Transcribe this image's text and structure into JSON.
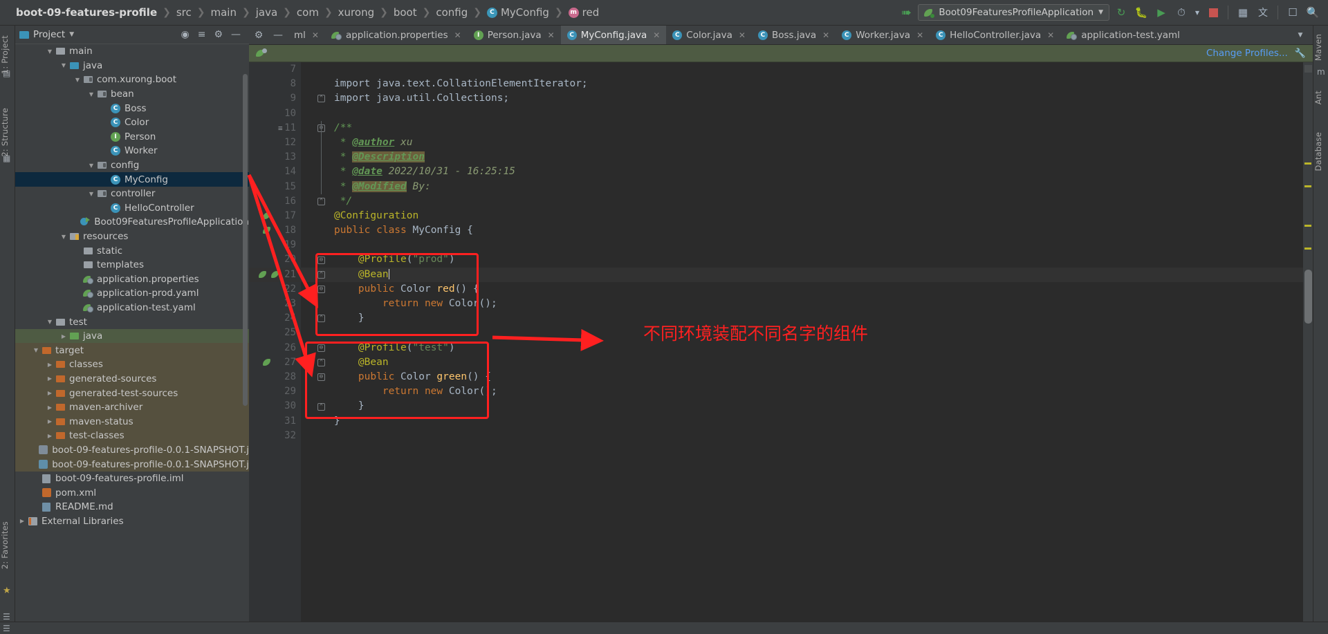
{
  "window": {
    "breadcrumb": [
      {
        "label": "boot-09-features-profile",
        "icon": "",
        "bold": true
      },
      {
        "label": "src",
        "icon": "",
        "bold": false
      },
      {
        "label": "main",
        "icon": "",
        "bold": false
      },
      {
        "label": "java",
        "icon": "",
        "bold": false
      },
      {
        "label": "com",
        "icon": "",
        "bold": false
      },
      {
        "label": "xurong",
        "icon": "",
        "bold": false
      },
      {
        "label": "boot",
        "icon": "",
        "bold": false
      },
      {
        "label": "config",
        "icon": "",
        "bold": false
      },
      {
        "label": "MyConfig",
        "icon": "class-icon",
        "bold": false
      },
      {
        "label": "red",
        "icon": "method-icon",
        "bold": false
      }
    ],
    "run_configuration": "Boot09FeaturesProfileApplication",
    "toolbar_icons": [
      "build-icon",
      "debug-icon",
      "run-with-coverage-icon",
      "profiler-icon",
      "stop-icon",
      "services-icon",
      "translate-icon",
      "terminal-icon",
      "search-everywhere-icon"
    ]
  },
  "left_tool_strip": [
    "1: Project",
    "2: Structure",
    "2: Favorites"
  ],
  "right_tool_strip": [
    "Maven",
    "Ant",
    "Database"
  ],
  "project_panel": {
    "title": "Project",
    "tree": [
      {
        "indent": 2,
        "arrow": "down",
        "icon": "folder-gray",
        "label": "main",
        "row": "normal"
      },
      {
        "indent": 3,
        "arrow": "down",
        "icon": "folder-blue",
        "label": "java",
        "row": "normal"
      },
      {
        "indent": 4,
        "arrow": "down",
        "icon": "package",
        "label": "com.xurong.boot",
        "row": "normal"
      },
      {
        "indent": 5,
        "arrow": "down",
        "icon": "package",
        "label": "bean",
        "row": "normal"
      },
      {
        "indent": 6,
        "arrow": "none",
        "icon": "class",
        "label": "Boss",
        "row": "normal"
      },
      {
        "indent": 6,
        "arrow": "none",
        "icon": "class",
        "label": "Color",
        "row": "normal"
      },
      {
        "indent": 6,
        "arrow": "none",
        "icon": "interface",
        "label": "Person",
        "row": "normal"
      },
      {
        "indent": 6,
        "arrow": "none",
        "icon": "class",
        "label": "Worker",
        "row": "normal"
      },
      {
        "indent": 5,
        "arrow": "down",
        "icon": "package",
        "label": "config",
        "row": "normal"
      },
      {
        "indent": 6,
        "arrow": "none",
        "icon": "class",
        "label": "MyConfig",
        "row": "selected"
      },
      {
        "indent": 5,
        "arrow": "down",
        "icon": "package",
        "label": "controller",
        "row": "normal"
      },
      {
        "indent": 6,
        "arrow": "none",
        "icon": "class",
        "label": "HelloController",
        "row": "normal"
      },
      {
        "indent": 5,
        "arrow": "none",
        "icon": "run-class",
        "label": "Boot09FeaturesProfileApplication",
        "row": "normal"
      },
      {
        "indent": 3,
        "arrow": "down",
        "icon": "folder-res",
        "label": "resources",
        "row": "normal"
      },
      {
        "indent": 4,
        "arrow": "none",
        "icon": "folder-gray",
        "label": "static",
        "row": "normal"
      },
      {
        "indent": 4,
        "arrow": "none",
        "icon": "folder-gray",
        "label": "templates",
        "row": "normal"
      },
      {
        "indent": 4,
        "arrow": "none",
        "icon": "spring-leaf",
        "label": "application.properties",
        "row": "normal"
      },
      {
        "indent": 4,
        "arrow": "none",
        "icon": "spring-leaf",
        "label": "application-prod.yaml",
        "row": "normal"
      },
      {
        "indent": 4,
        "arrow": "none",
        "icon": "spring-leaf",
        "label": "application-test.yaml",
        "row": "normal"
      },
      {
        "indent": 2,
        "arrow": "down",
        "icon": "folder-gray",
        "label": "test",
        "row": "normal"
      },
      {
        "indent": 3,
        "arrow": "right",
        "icon": "folder-green",
        "label": "java",
        "row": "green"
      },
      {
        "indent": 1,
        "arrow": "down",
        "icon": "folder-orange",
        "label": "target",
        "row": "brown"
      },
      {
        "indent": 2,
        "arrow": "right",
        "icon": "folder-orange",
        "label": "classes",
        "row": "brown"
      },
      {
        "indent": 2,
        "arrow": "right",
        "icon": "folder-orange",
        "label": "generated-sources",
        "row": "brown"
      },
      {
        "indent": 2,
        "arrow": "right",
        "icon": "folder-orange",
        "label": "generated-test-sources",
        "row": "brown"
      },
      {
        "indent": 2,
        "arrow": "right",
        "icon": "folder-orange",
        "label": "maven-archiver",
        "row": "brown"
      },
      {
        "indent": 2,
        "arrow": "right",
        "icon": "folder-orange",
        "label": "maven-status",
        "row": "brown"
      },
      {
        "indent": 2,
        "arrow": "right",
        "icon": "folder-orange",
        "label": "test-classes",
        "row": "brown"
      },
      {
        "indent": 2,
        "arrow": "none",
        "icon": "jar",
        "label": "boot-09-features-profile-0.0.1-SNAPSHOT.j",
        "row": "brown"
      },
      {
        "indent": 2,
        "arrow": "none",
        "icon": "jar-blue",
        "label": "boot-09-features-profile-0.0.1-SNAPSHOT.j",
        "row": "brown"
      },
      {
        "indent": 1,
        "arrow": "none",
        "icon": "iml",
        "label": "boot-09-features-profile.iml",
        "row": "normal"
      },
      {
        "indent": 1,
        "arrow": "none",
        "icon": "maven",
        "label": "pom.xml",
        "row": "normal"
      },
      {
        "indent": 1,
        "arrow": "none",
        "icon": "markdown",
        "label": "README.md",
        "row": "normal"
      },
      {
        "indent": 0,
        "arrow": "right",
        "icon": "libraries",
        "label": "External Libraries",
        "row": "normal"
      }
    ]
  },
  "editor": {
    "tabs": [
      {
        "label": "ml",
        "icon": "none",
        "active": false,
        "closable": true
      },
      {
        "label": "application.properties",
        "icon": "spring",
        "active": false,
        "closable": true
      },
      {
        "label": "Person.java",
        "icon": "interface",
        "active": false,
        "closable": true
      },
      {
        "label": "MyConfig.java",
        "icon": "class",
        "active": true,
        "closable": true
      },
      {
        "label": "Color.java",
        "icon": "class",
        "active": false,
        "closable": true
      },
      {
        "label": "Boss.java",
        "icon": "class",
        "active": false,
        "closable": true
      },
      {
        "label": "Worker.java",
        "icon": "class",
        "active": false,
        "closable": true
      },
      {
        "label": "HelloController.java",
        "icon": "class",
        "active": false,
        "closable": true
      },
      {
        "label": "application-test.yaml",
        "icon": "spring",
        "active": false,
        "closable": false
      }
    ],
    "notification_bar": {
      "icon": "spring-profile-icon",
      "action_label": "Change Profiles...",
      "settings_icon": "wrench-icon"
    },
    "first_line_number": 7,
    "current_line": 21,
    "lines": [
      {
        "n": 7,
        "tokens": []
      },
      {
        "n": 8,
        "tokens": [
          {
            "t": "import java.text.CollationElementIterator;",
            "c": "plain"
          }
        ]
      },
      {
        "n": 9,
        "tokens": [
          {
            "t": "import java.util.Collections;",
            "c": "plain"
          }
        ]
      },
      {
        "n": 10,
        "tokens": []
      },
      {
        "n": 11,
        "tokens": [
          {
            "t": "/**",
            "c": "cmt"
          }
        ]
      },
      {
        "n": 12,
        "tokens": [
          {
            "t": " * ",
            "c": "cmt"
          },
          {
            "t": "@author",
            "c": "tag"
          },
          {
            "t": " xu",
            "c": "cmtt"
          }
        ]
      },
      {
        "n": 13,
        "tokens": [
          {
            "t": " * ",
            "c": "cmt"
          },
          {
            "t": "@Description",
            "c": "tag-hl"
          }
        ]
      },
      {
        "n": 14,
        "tokens": [
          {
            "t": " * ",
            "c": "cmt"
          },
          {
            "t": "@date",
            "c": "tag"
          },
          {
            "t": " 2022/10/31 - 16:25:15",
            "c": "cmtt"
          }
        ]
      },
      {
        "n": 15,
        "tokens": [
          {
            "t": " * ",
            "c": "cmt"
          },
          {
            "t": "@Modified",
            "c": "tag-hl"
          },
          {
            "t": " By:",
            "c": "cmtt"
          }
        ]
      },
      {
        "n": 16,
        "tokens": [
          {
            "t": " */",
            "c": "cmt"
          }
        ]
      },
      {
        "n": 17,
        "tokens": [
          {
            "t": "@Configuration",
            "c": "anno"
          }
        ]
      },
      {
        "n": 18,
        "tokens": [
          {
            "t": "public class ",
            "c": "kw"
          },
          {
            "t": "MyConfig {",
            "c": "plain"
          }
        ]
      },
      {
        "n": 19,
        "tokens": []
      },
      {
        "n": 20,
        "tokens": [
          {
            "t": "    ",
            "c": "plain"
          },
          {
            "t": "@Profile",
            "c": "anno"
          },
          {
            "t": "(",
            "c": "paren"
          },
          {
            "t": "\"prod\"",
            "c": "str"
          },
          {
            "t": ")",
            "c": "paren"
          }
        ]
      },
      {
        "n": 21,
        "tokens": [
          {
            "t": "    ",
            "c": "plain"
          },
          {
            "t": "@Bean",
            "c": "anno"
          }
        ],
        "caret": true
      },
      {
        "n": 22,
        "tokens": [
          {
            "t": "    ",
            "c": "plain"
          },
          {
            "t": "public ",
            "c": "kw"
          },
          {
            "t": "Color ",
            "c": "plain"
          },
          {
            "t": "red",
            "c": "fn"
          },
          {
            "t": "() {",
            "c": "plain"
          }
        ]
      },
      {
        "n": 23,
        "tokens": [
          {
            "t": "        ",
            "c": "plain"
          },
          {
            "t": "return new ",
            "c": "kw"
          },
          {
            "t": "Color();",
            "c": "plain"
          }
        ]
      },
      {
        "n": 24,
        "tokens": [
          {
            "t": "    }",
            "c": "plain"
          }
        ]
      },
      {
        "n": 25,
        "tokens": []
      },
      {
        "n": 26,
        "tokens": [
          {
            "t": "    ",
            "c": "plain"
          },
          {
            "t": "@Profile",
            "c": "anno"
          },
          {
            "t": "(",
            "c": "paren"
          },
          {
            "t": "\"test\"",
            "c": "str"
          },
          {
            "t": ")",
            "c": "paren"
          }
        ]
      },
      {
        "n": 27,
        "tokens": [
          {
            "t": "    ",
            "c": "plain"
          },
          {
            "t": "@Bean",
            "c": "anno"
          }
        ]
      },
      {
        "n": 28,
        "tokens": [
          {
            "t": "    ",
            "c": "plain"
          },
          {
            "t": "public ",
            "c": "kw"
          },
          {
            "t": "Color ",
            "c": "plain"
          },
          {
            "t": "green",
            "c": "fn"
          },
          {
            "t": "() {",
            "c": "plain"
          }
        ]
      },
      {
        "n": 29,
        "tokens": [
          {
            "t": "        ",
            "c": "plain"
          },
          {
            "t": "return new ",
            "c": "kw"
          },
          {
            "t": "Color();",
            "c": "plain"
          }
        ]
      },
      {
        "n": 30,
        "tokens": [
          {
            "t": "    }",
            "c": "plain"
          }
        ]
      },
      {
        "n": 31,
        "tokens": [
          {
            "t": "}",
            "c": "plain"
          }
        ]
      },
      {
        "n": 32,
        "tokens": []
      }
    ]
  },
  "annotations": {
    "note_text": "不同环境装配不同名字的组件",
    "note_color": "#ff2020",
    "box_color": "#ff2020"
  }
}
